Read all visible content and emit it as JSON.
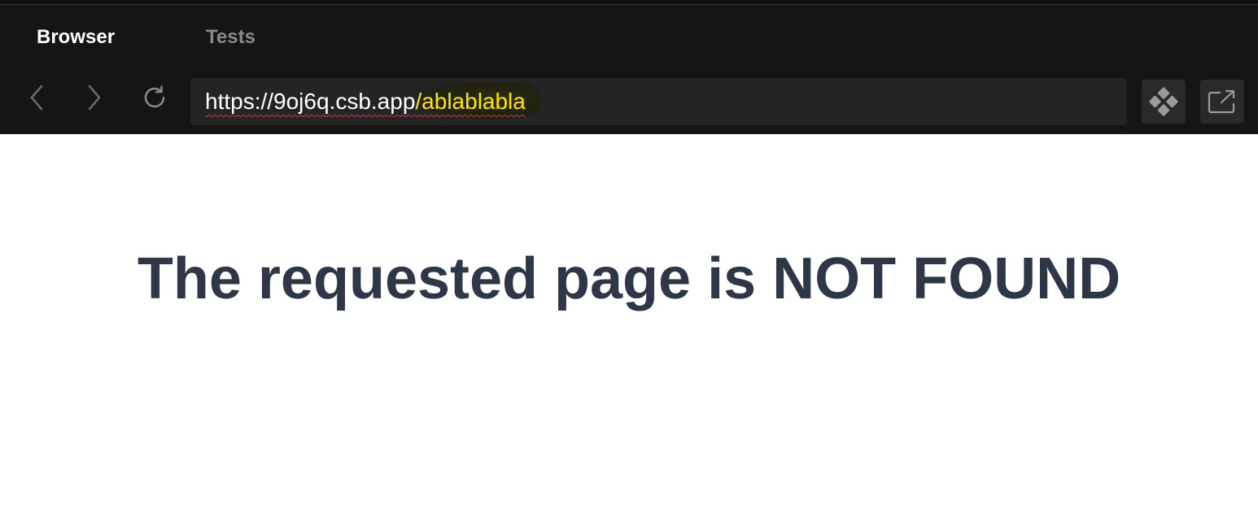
{
  "tabs": [
    {
      "label": "Browser",
      "active": true
    },
    {
      "label": "Tests",
      "active": false
    }
  ],
  "nav": {
    "back_icon": "chevron-left",
    "forward_icon": "chevron-right",
    "refresh_icon": "refresh"
  },
  "address": {
    "host": "https://9oj6q.csb.app",
    "path": "/ablablabla"
  },
  "tools": {
    "devtools_icon": "diamond-grid",
    "open_external_icon": "open-in-new-window"
  },
  "page": {
    "heading": "The requested page is NOT FOUND"
  },
  "colors": {
    "chrome_bg": "#151515",
    "address_bg": "#242424",
    "path_highlight": "#ffe500",
    "heading": "#2d3748"
  }
}
